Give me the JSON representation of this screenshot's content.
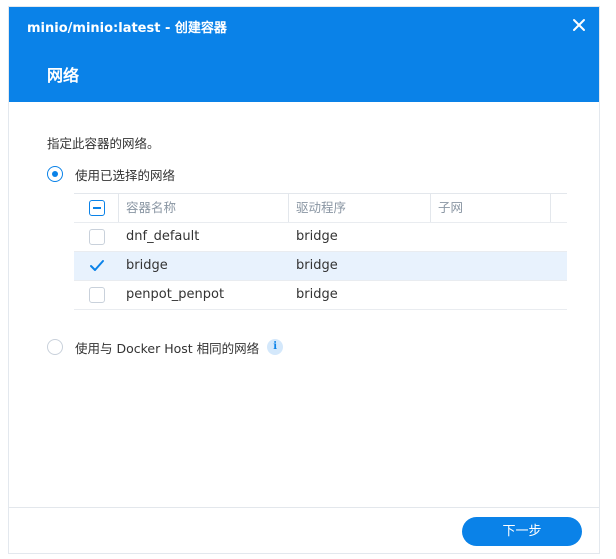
{
  "window": {
    "title": "minio/minio:latest - 创建容器",
    "section_title": "网络"
  },
  "content": {
    "description": "指定此容器的网络。",
    "option_selected_network": "使用已选择的网络",
    "option_host_network": "使用与 Docker Host 相同的网络"
  },
  "table": {
    "columns": [
      "容器名称",
      "驱动程序",
      "子网"
    ],
    "rows": [
      {
        "name": "dnf_default",
        "driver": "bridge",
        "subnet": "",
        "checked": false
      },
      {
        "name": "bridge",
        "driver": "bridge",
        "subnet": "",
        "checked": true
      },
      {
        "name": "penpot_penpot",
        "driver": "bridge",
        "subnet": "",
        "checked": false
      }
    ]
  },
  "footer": {
    "next_label": "下一步"
  },
  "icons": {
    "close": "close-icon",
    "info": "info-icon",
    "check": "checkmark-icon"
  },
  "colors": {
    "accent": "#0a82e8",
    "selected_row": "#e8f2fd"
  }
}
